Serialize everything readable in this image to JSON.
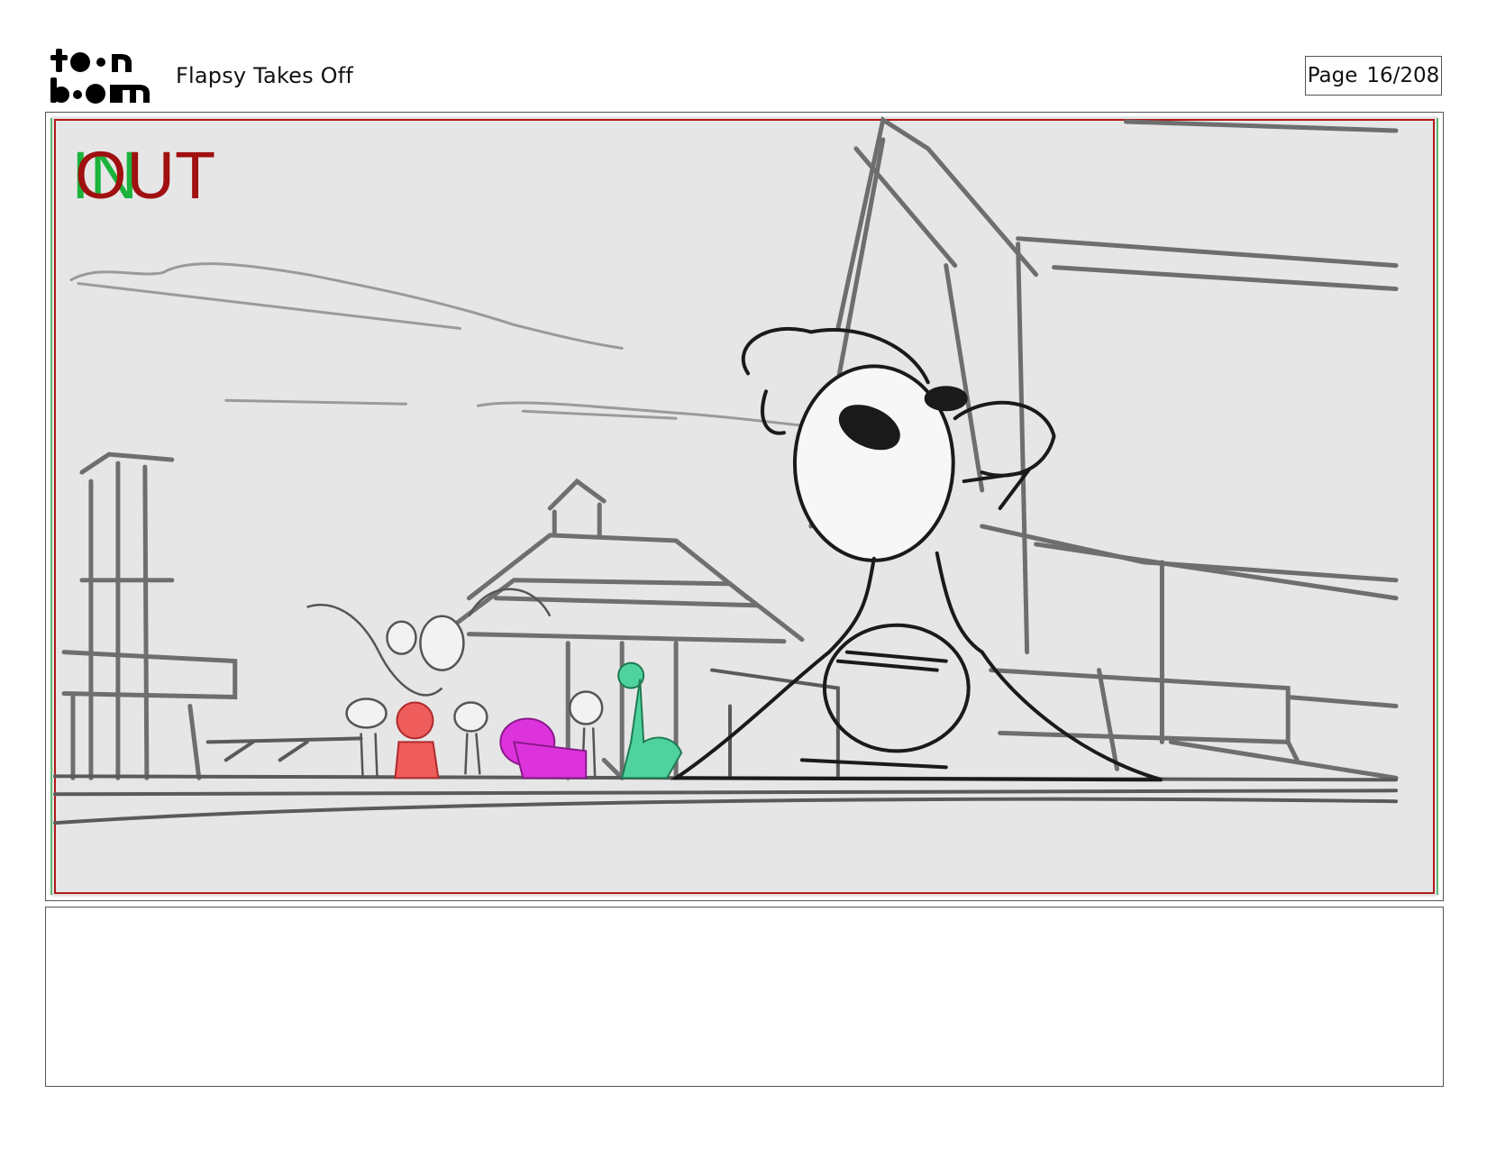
{
  "header": {
    "logo_alt": "toon boom",
    "title": "Flapsy Takes Off",
    "page_label": "Page",
    "page_number": "16/208"
  },
  "panel": {
    "in_marker": "IN",
    "out_marker": "OUT"
  },
  "notes": {
    "text": ""
  }
}
